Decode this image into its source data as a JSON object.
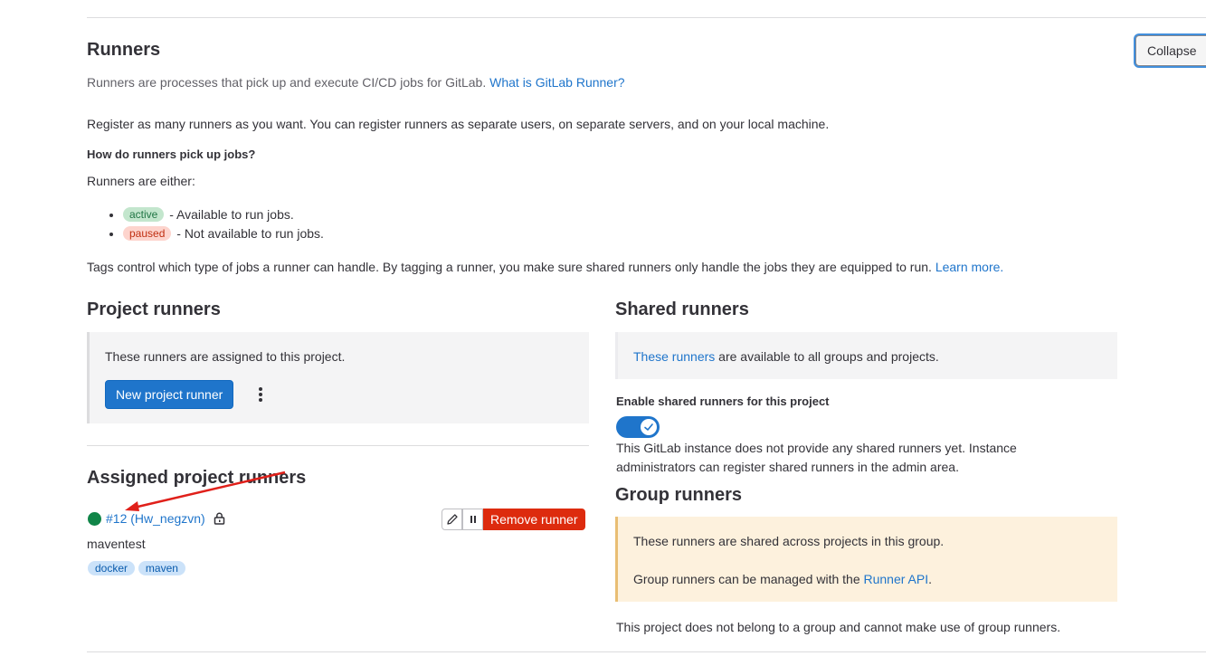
{
  "runners": {
    "title": "Runners",
    "collapse_label": "Collapse",
    "description": "Runners are processes that pick up and execute CI/CD jobs for GitLab.",
    "what_is_link": "What is GitLab Runner?",
    "register_text": "Register as many runners as you want. You can register runners as separate users, on separate servers, and on your local machine.",
    "how_heading": "How do runners pick up jobs?",
    "either_text": "Runners are either:",
    "states": [
      {
        "badge": "active",
        "text": "- Available to run jobs."
      },
      {
        "badge": "paused",
        "text": "- Not available to run jobs."
      }
    ],
    "tags_text": "Tags control which type of jobs a runner can handle. By tagging a runner, you make sure shared runners only handle the jobs they are equipped to run.",
    "learn_more": "Learn more."
  },
  "project_runners": {
    "title": "Project runners",
    "panel_text": "These runners are assigned to this project.",
    "new_button": "New project runner",
    "assigned_title": "Assigned project runners",
    "runner": {
      "status_color": "#108548",
      "link": "#12 (Hw_negzvn)",
      "description": "maventest",
      "tags": [
        "docker",
        "maven"
      ],
      "remove_button": "Remove runner"
    }
  },
  "shared_runners": {
    "title": "Shared runners",
    "panel_link": "These runners",
    "panel_text": " are available to all groups and projects.",
    "enable_label": "Enable shared runners for this project",
    "toggle_on": true,
    "note_line1": "This GitLab instance does not provide any shared runners yet. Instance",
    "note_line2": "administrators can register shared runners in the admin area."
  },
  "group_runners": {
    "title": "Group runners",
    "panel_line1": "These runners are shared across projects in this group.",
    "panel_line2_prefix": "Group runners can be managed with the ",
    "panel_line2_link": "Runner API",
    "panel_line2_suffix": ".",
    "footer_text": "This project does not belong to a group and cannot make use of group runners."
  },
  "colors": {
    "primary": "#1f75cb",
    "danger": "#dd2b0e",
    "active_badge_bg": "#c3e6cd",
    "paused_badge_bg": "#fdd4cd",
    "warning_panel_bg": "#fdf1dd",
    "annotation_arrow": "#e0201a"
  }
}
